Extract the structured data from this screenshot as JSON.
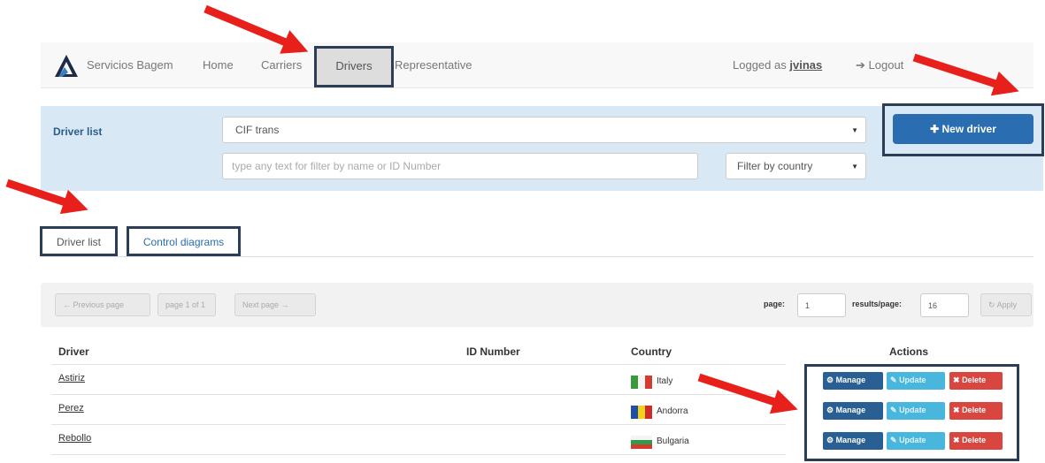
{
  "navbar": {
    "brand": "Servicios Bagem",
    "links": [
      "Home",
      "Carriers",
      "Drivers",
      "Representative"
    ],
    "active": "Drivers",
    "logged_prefix": "Logged as",
    "username": "jvinas",
    "logout": "Logout"
  },
  "filter_panel": {
    "title": "Driver list",
    "carrier_select": "CIF trans",
    "text_placeholder": "type any text for filter by name or ID Number",
    "country_filter": "Filter by country",
    "new_driver_button": "New driver"
  },
  "tabs": [
    "Driver list",
    "Control diagrams"
  ],
  "pager": {
    "previous": "Previous page",
    "page_info": "page 1 of 1",
    "next": "Next page",
    "page_label": "page:",
    "page_value": "1",
    "results_label": "results/page:",
    "results_value": "16",
    "apply": "Apply"
  },
  "table": {
    "headers": {
      "driver": "Driver",
      "id_number": "ID Number",
      "country": "Country",
      "actions": "Actions"
    },
    "rows": [
      {
        "driver": "Astiriz",
        "id_number": "",
        "country": "Italy"
      },
      {
        "driver": "Perez",
        "id_number": "",
        "country": "Andorra"
      },
      {
        "driver": "Rebollo",
        "id_number": "",
        "country": "Bulgaria"
      }
    ],
    "action_labels": {
      "manage": "Manage",
      "update": "Update",
      "delete": "Delete"
    }
  },
  "colors": {
    "primary": "#2a6db0",
    "panel": "#d8e9f5",
    "highlight_frame": "#2c3e55",
    "arrow": "#e8201b",
    "manage": "#2a5f94",
    "update": "#48b6dd",
    "delete": "#d9463f"
  },
  "icons": [
    "brand-logo",
    "logout-icon",
    "plus-icon",
    "arrow-left-icon",
    "arrow-right-icon",
    "refresh-icon",
    "gear-icon",
    "pencil-icon",
    "x-icon",
    "flag-italy",
    "flag-andorra",
    "flag-bulgaria",
    "annotation-arrow"
  ]
}
